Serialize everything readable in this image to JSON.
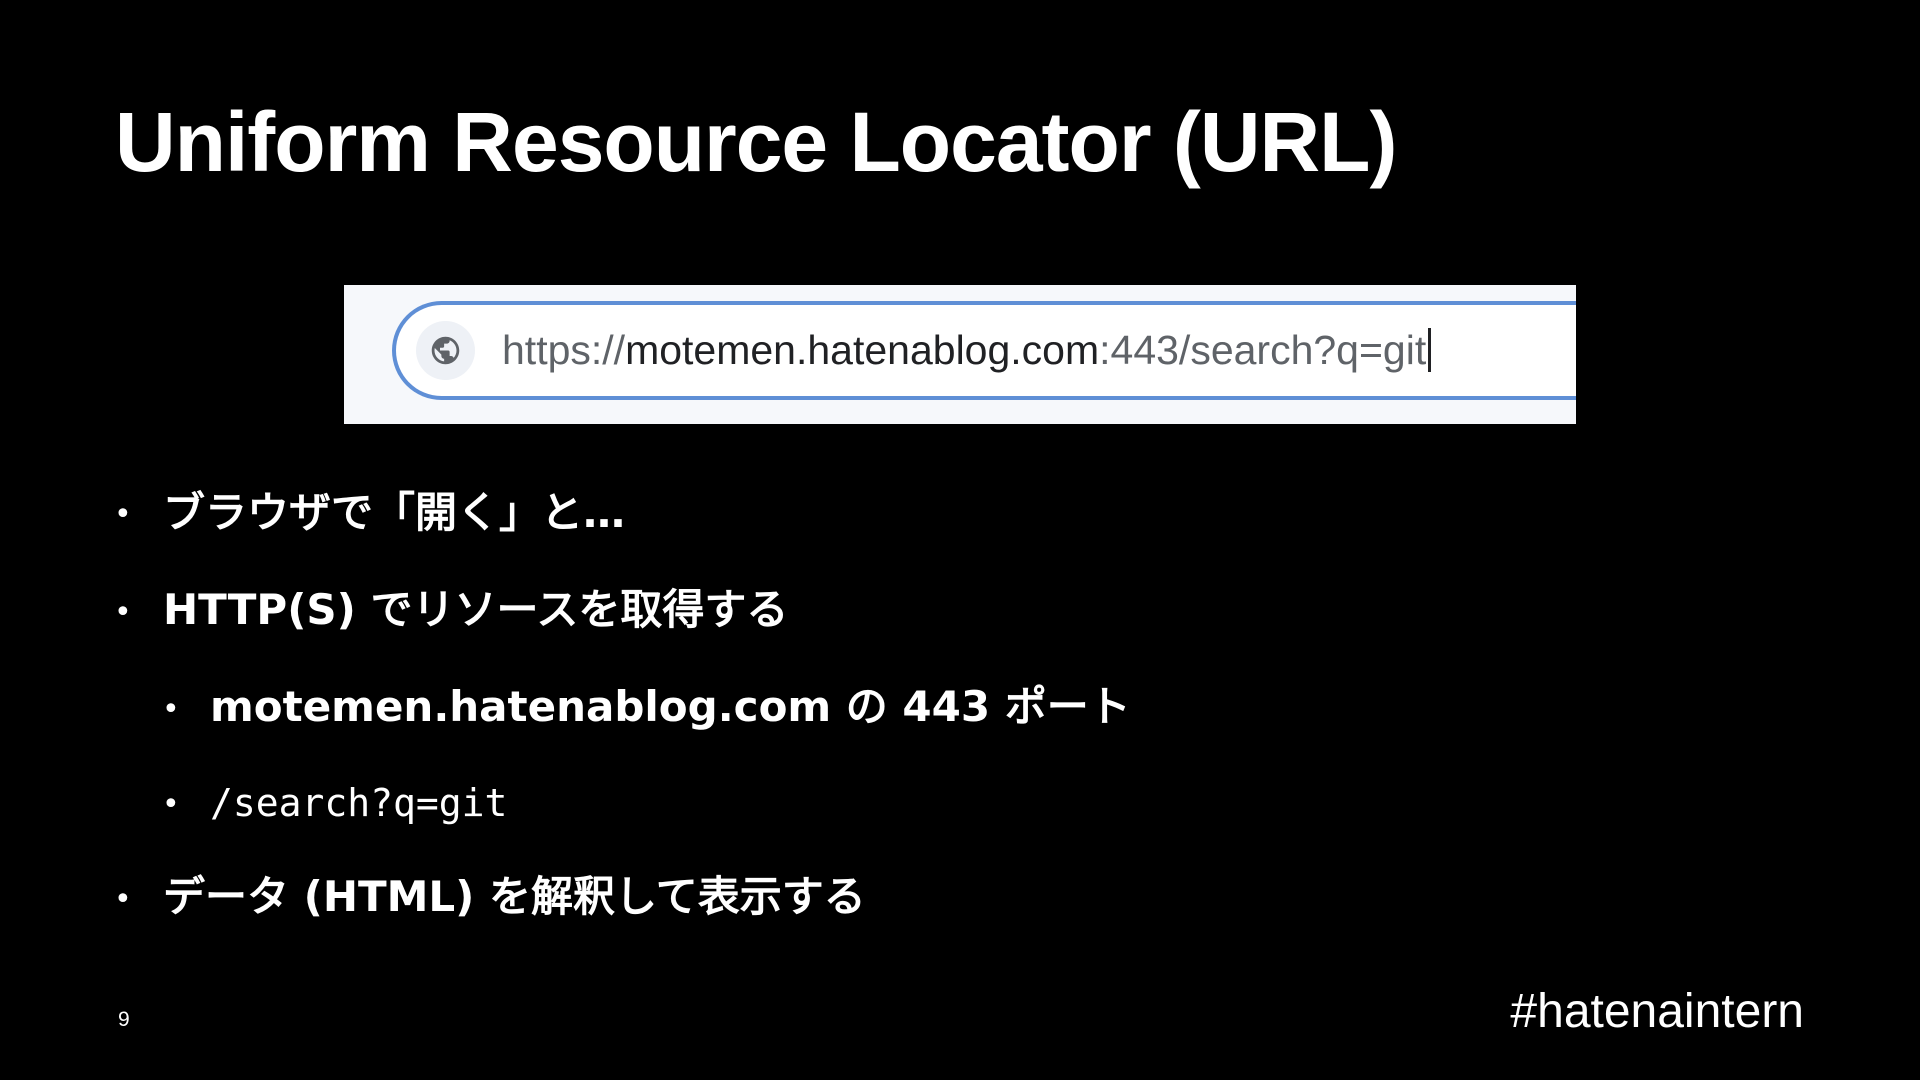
{
  "slide": {
    "title": "Uniform Resource Locator (URL)",
    "url_bar": {
      "icon": "globe-icon",
      "scheme": "https://",
      "host": "motemen.hatenablog.com",
      "rest": ":443/search?q=git"
    },
    "bullets": [
      "ブラウザで「開く」と…",
      "HTTP(S) でリソースを取得する",
      "motemen.hatenablog.com の 443 ポート",
      "/search?q=git",
      "データ (HTML) を解釈して表示する"
    ],
    "bullet_glyph": "•",
    "page_number": "9",
    "hashtag": "#hatenaintern"
  }
}
